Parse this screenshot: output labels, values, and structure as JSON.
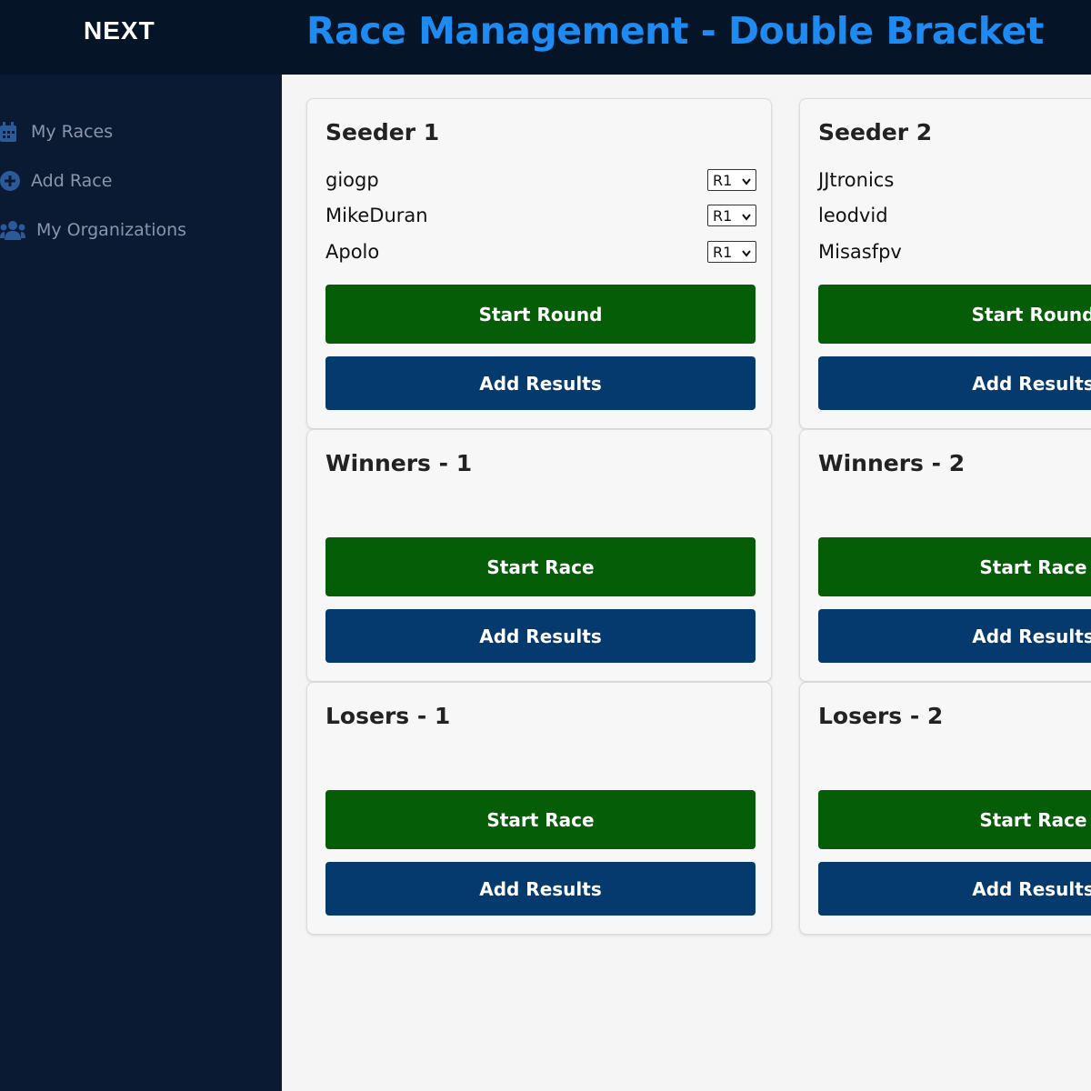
{
  "app": {
    "logo": "NEXT"
  },
  "header": {
    "title": "Race Management - Double Bracket"
  },
  "sidebar": {
    "items": [
      {
        "label": "My Races",
        "icon": "calendar-icon"
      },
      {
        "label": "Add Race",
        "icon": "plus-circle-icon"
      },
      {
        "label": "My Organizations",
        "icon": "users-icon"
      }
    ]
  },
  "colors": {
    "accent": "#1d8bf1",
    "sidebar": "#0b1a33",
    "start_button": "#055e07",
    "results_button": "#053a6f"
  },
  "cards": [
    {
      "title": "Seeder 1",
      "racers": [
        {
          "name": "giogp",
          "round": "R1"
        },
        {
          "name": "MikeDuran",
          "round": "R1"
        },
        {
          "name": "Apolo",
          "round": "R1"
        }
      ],
      "start_label": "Start Round",
      "results_label": "Add Results"
    },
    {
      "title": "Seeder 2",
      "racers": [
        {
          "name": "JJtronics"
        },
        {
          "name": "leodvid"
        },
        {
          "name": "Misasfpv"
        }
      ],
      "start_label": "Start Round",
      "results_label": "Add Results"
    },
    {
      "title": "Winners - 1",
      "start_label": "Start Race",
      "results_label": "Add Results"
    },
    {
      "title": "Winners - 2",
      "start_label": "Start Race",
      "results_label": "Add Results"
    },
    {
      "title": "Losers - 1",
      "start_label": "Start Race",
      "results_label": "Add Results"
    },
    {
      "title": "Losers - 2",
      "start_label": "Start Race",
      "results_label": "Add Results"
    }
  ]
}
